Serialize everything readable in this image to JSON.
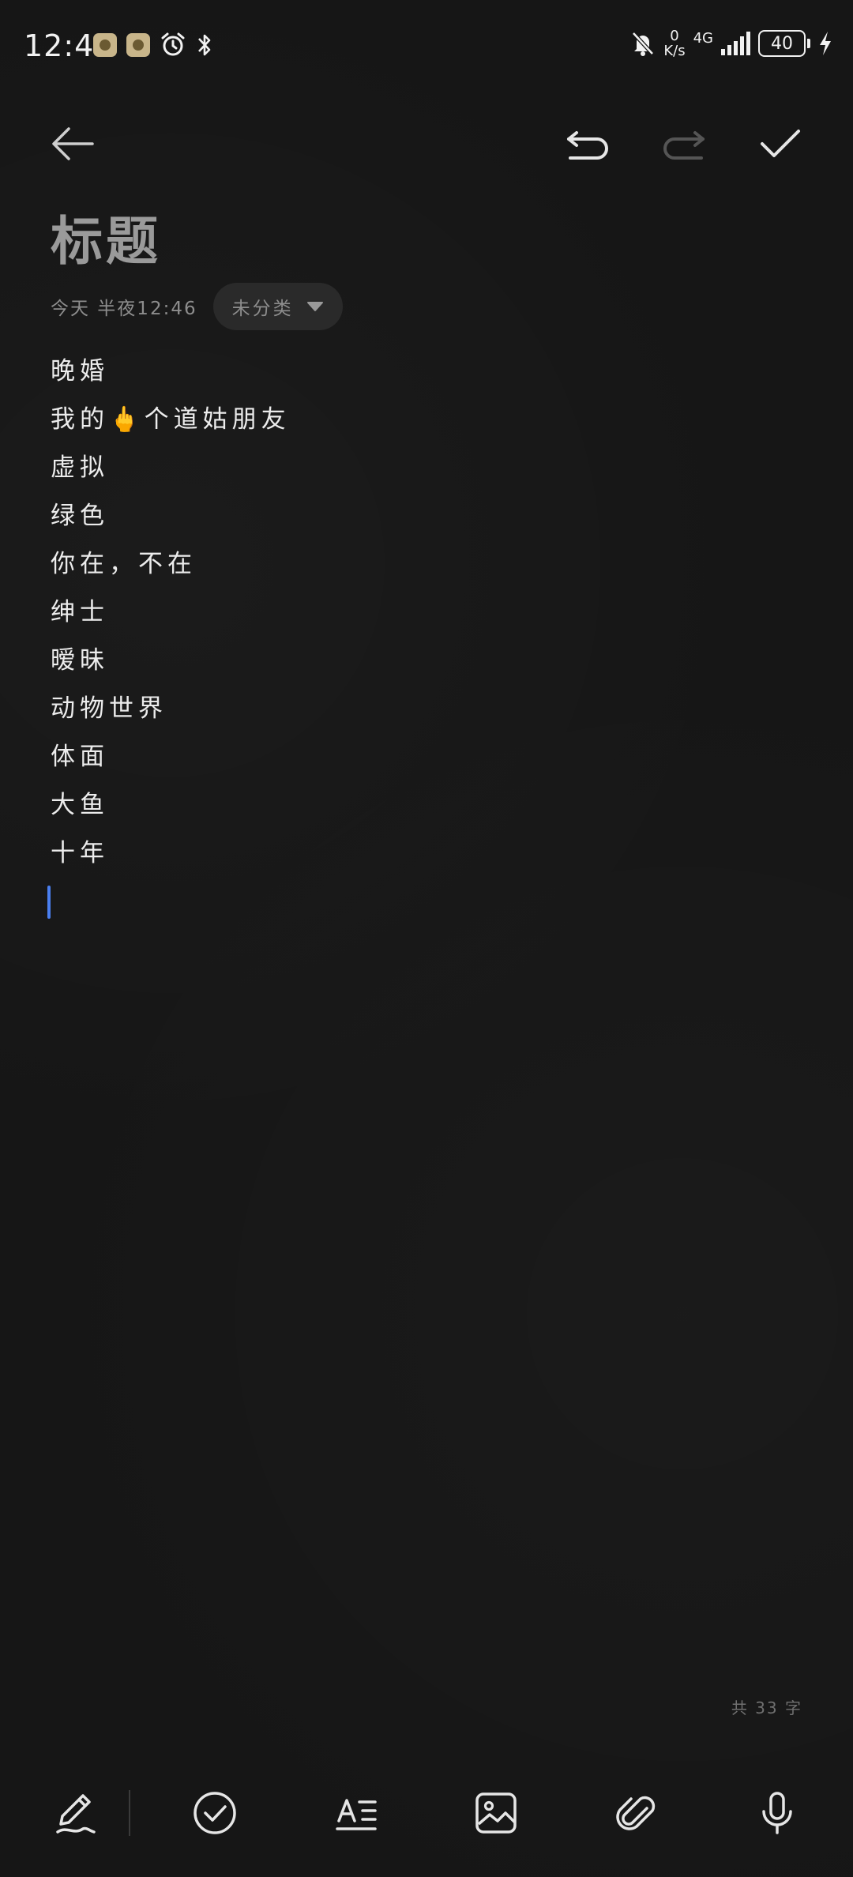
{
  "status_bar": {
    "time": "12:46",
    "net_speed_value": "0",
    "net_speed_unit": "K/s",
    "network_type": "4G",
    "battery": "40"
  },
  "note": {
    "title": "标题",
    "date": "今天 半夜12:46",
    "category": "未分类",
    "lines": [
      "晚婚",
      "我的🖕个道姑朋友",
      "虚拟",
      "绿色",
      "你在，不在",
      "绅士",
      "暧昧",
      "动物世界",
      "体面",
      "大鱼",
      "十年"
    ],
    "word_count": "共 33 字"
  },
  "icons": {
    "back": "arrow-left-icon",
    "undo": "undo-icon",
    "redo": "redo-icon",
    "confirm": "check-icon",
    "handwriting": "pen-icon",
    "checklist": "check-circle-icon",
    "text_format": "text-format-icon",
    "image": "image-icon",
    "attachment": "paperclip-icon",
    "voice": "microphone-icon"
  },
  "colors": {
    "background": "#161616",
    "text": "#ececec",
    "muted": "#8d8d8d",
    "cursor": "#4a7ff0",
    "disabled": "#5a5a5a"
  }
}
